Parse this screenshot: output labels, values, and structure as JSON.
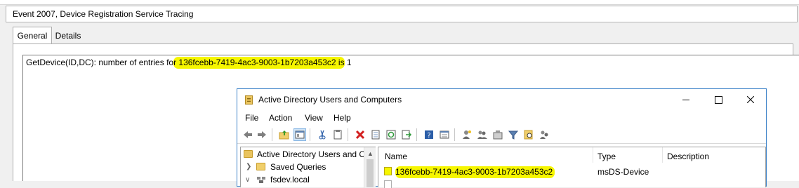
{
  "event_viewer": {
    "title": "Event 2007, Device Registration Service Tracing",
    "tabs": [
      {
        "label": "General",
        "selected": true
      },
      {
        "label": "Details",
        "selected": false
      }
    ],
    "message": {
      "prefix": "GetDevice(ID,DC): number of entries fo",
      "highlight_1": "r 136fcebb-7419-4ac3-9003-1b7203a453c2 is",
      "suffix": " 1"
    },
    "highlight_color": "#f6f600"
  },
  "aduc": {
    "title": "Active Directory Users and Computers",
    "window_controls": [
      "minimize-icon",
      "maximize-icon",
      "close-icon"
    ],
    "menu": [
      "File",
      "Action",
      "View",
      "Help"
    ],
    "toolbar_icons": [
      "back-arrow-icon",
      "forward-arrow-icon",
      "up-folder-icon",
      "show-hide-console-tree-icon",
      "cut-icon",
      "copy-icon",
      "delete-icon",
      "properties-icon",
      "refresh-icon",
      "export-list-icon",
      "help-icon",
      "details-view-icon",
      "new-user-icon",
      "new-group-icon",
      "new-ou-icon",
      "filter-icon",
      "find-icon",
      "add-to-group-icon"
    ],
    "tree": {
      "items": [
        {
          "label": "Active Directory Users and Co",
          "icon": "aduc-root-icon"
        },
        {
          "label": "Saved Queries",
          "icon": "folder-icon"
        },
        {
          "label": "fsdev.local",
          "icon": "domain-icon"
        }
      ]
    },
    "list": {
      "columns": [
        "Name",
        "Type",
        "Description"
      ],
      "rows": [
        {
          "name": "136fcebb-7419-4ac3-9003-1b7203a453c2",
          "type": "msDS-Device",
          "description": ""
        }
      ]
    },
    "accent_color": "#3c82c8"
  }
}
